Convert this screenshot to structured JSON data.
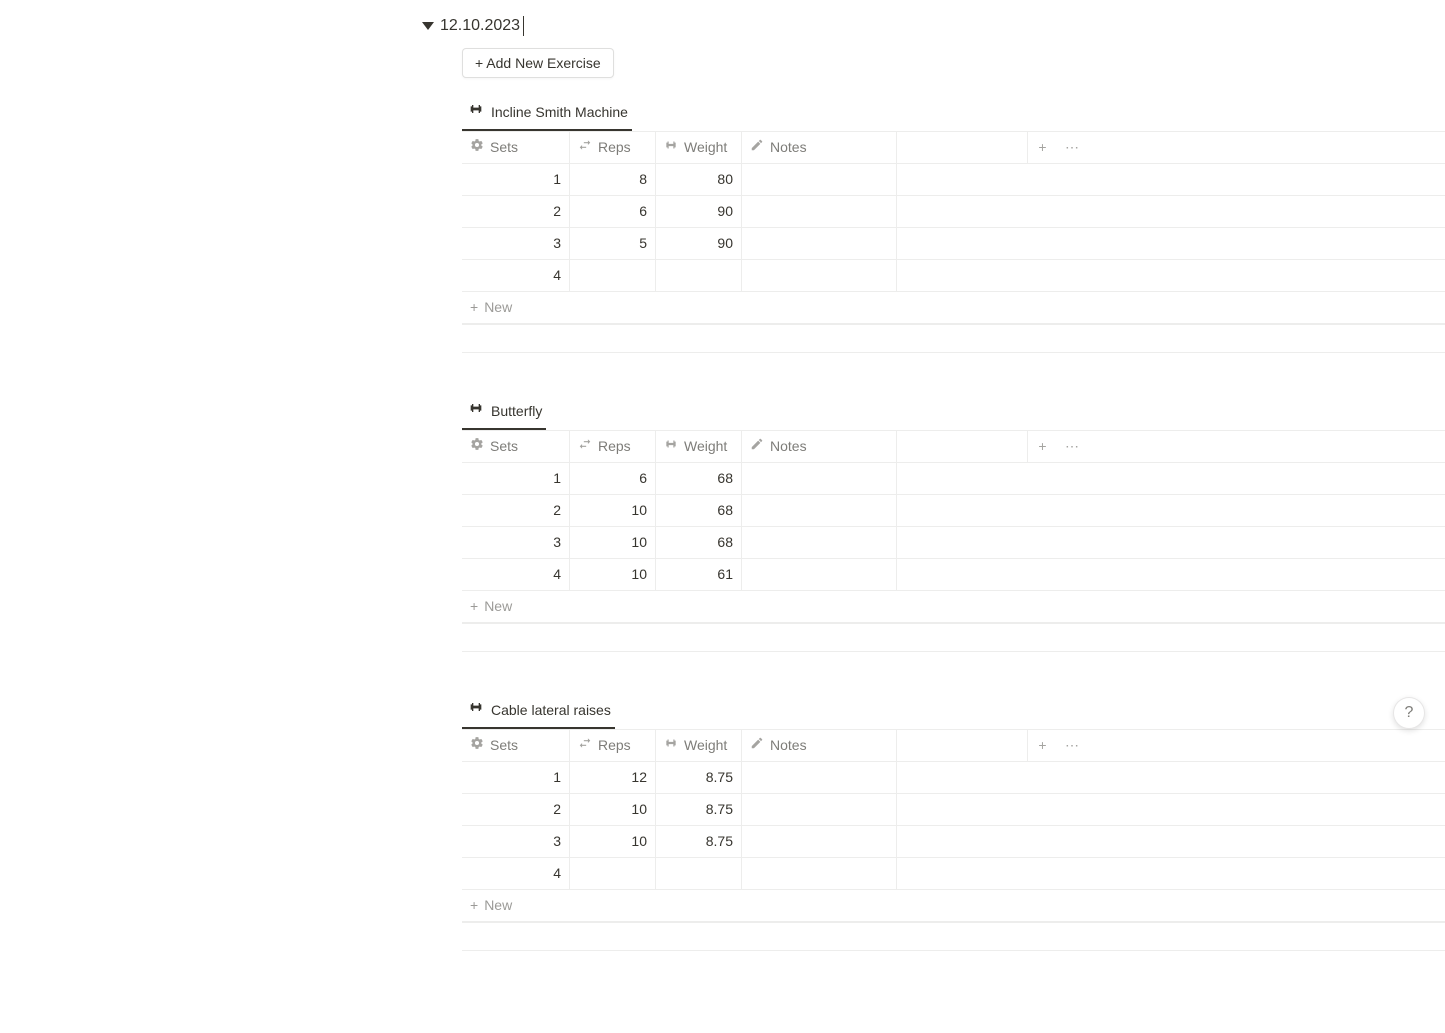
{
  "date": "12.10.2023",
  "add_button": "+ Add New Exercise",
  "new_label": "New",
  "help": "?",
  "columns": {
    "sets": "Sets",
    "reps": "Reps",
    "weight": "Weight",
    "notes": "Notes"
  },
  "exercises": [
    {
      "name": "Incline Smith Machine",
      "rows": [
        {
          "set": "1",
          "reps": "8",
          "weight": "80",
          "notes": ""
        },
        {
          "set": "2",
          "reps": "6",
          "weight": "90",
          "notes": ""
        },
        {
          "set": "3",
          "reps": "5",
          "weight": "90",
          "notes": ""
        },
        {
          "set": "4",
          "reps": "",
          "weight": "",
          "notes": ""
        }
      ]
    },
    {
      "name": "Butterfly",
      "rows": [
        {
          "set": "1",
          "reps": "6",
          "weight": "68",
          "notes": ""
        },
        {
          "set": "2",
          "reps": "10",
          "weight": "68",
          "notes": ""
        },
        {
          "set": "3",
          "reps": "10",
          "weight": "68",
          "notes": ""
        },
        {
          "set": "4",
          "reps": "10",
          "weight": "61",
          "notes": ""
        }
      ]
    },
    {
      "name": "Cable lateral raises",
      "rows": [
        {
          "set": "1",
          "reps": "12",
          "weight": "8.75",
          "notes": ""
        },
        {
          "set": "2",
          "reps": "10",
          "weight": "8.75",
          "notes": ""
        },
        {
          "set": "3",
          "reps": "10",
          "weight": "8.75",
          "notes": ""
        },
        {
          "set": "4",
          "reps": "",
          "weight": "",
          "notes": ""
        }
      ]
    }
  ]
}
